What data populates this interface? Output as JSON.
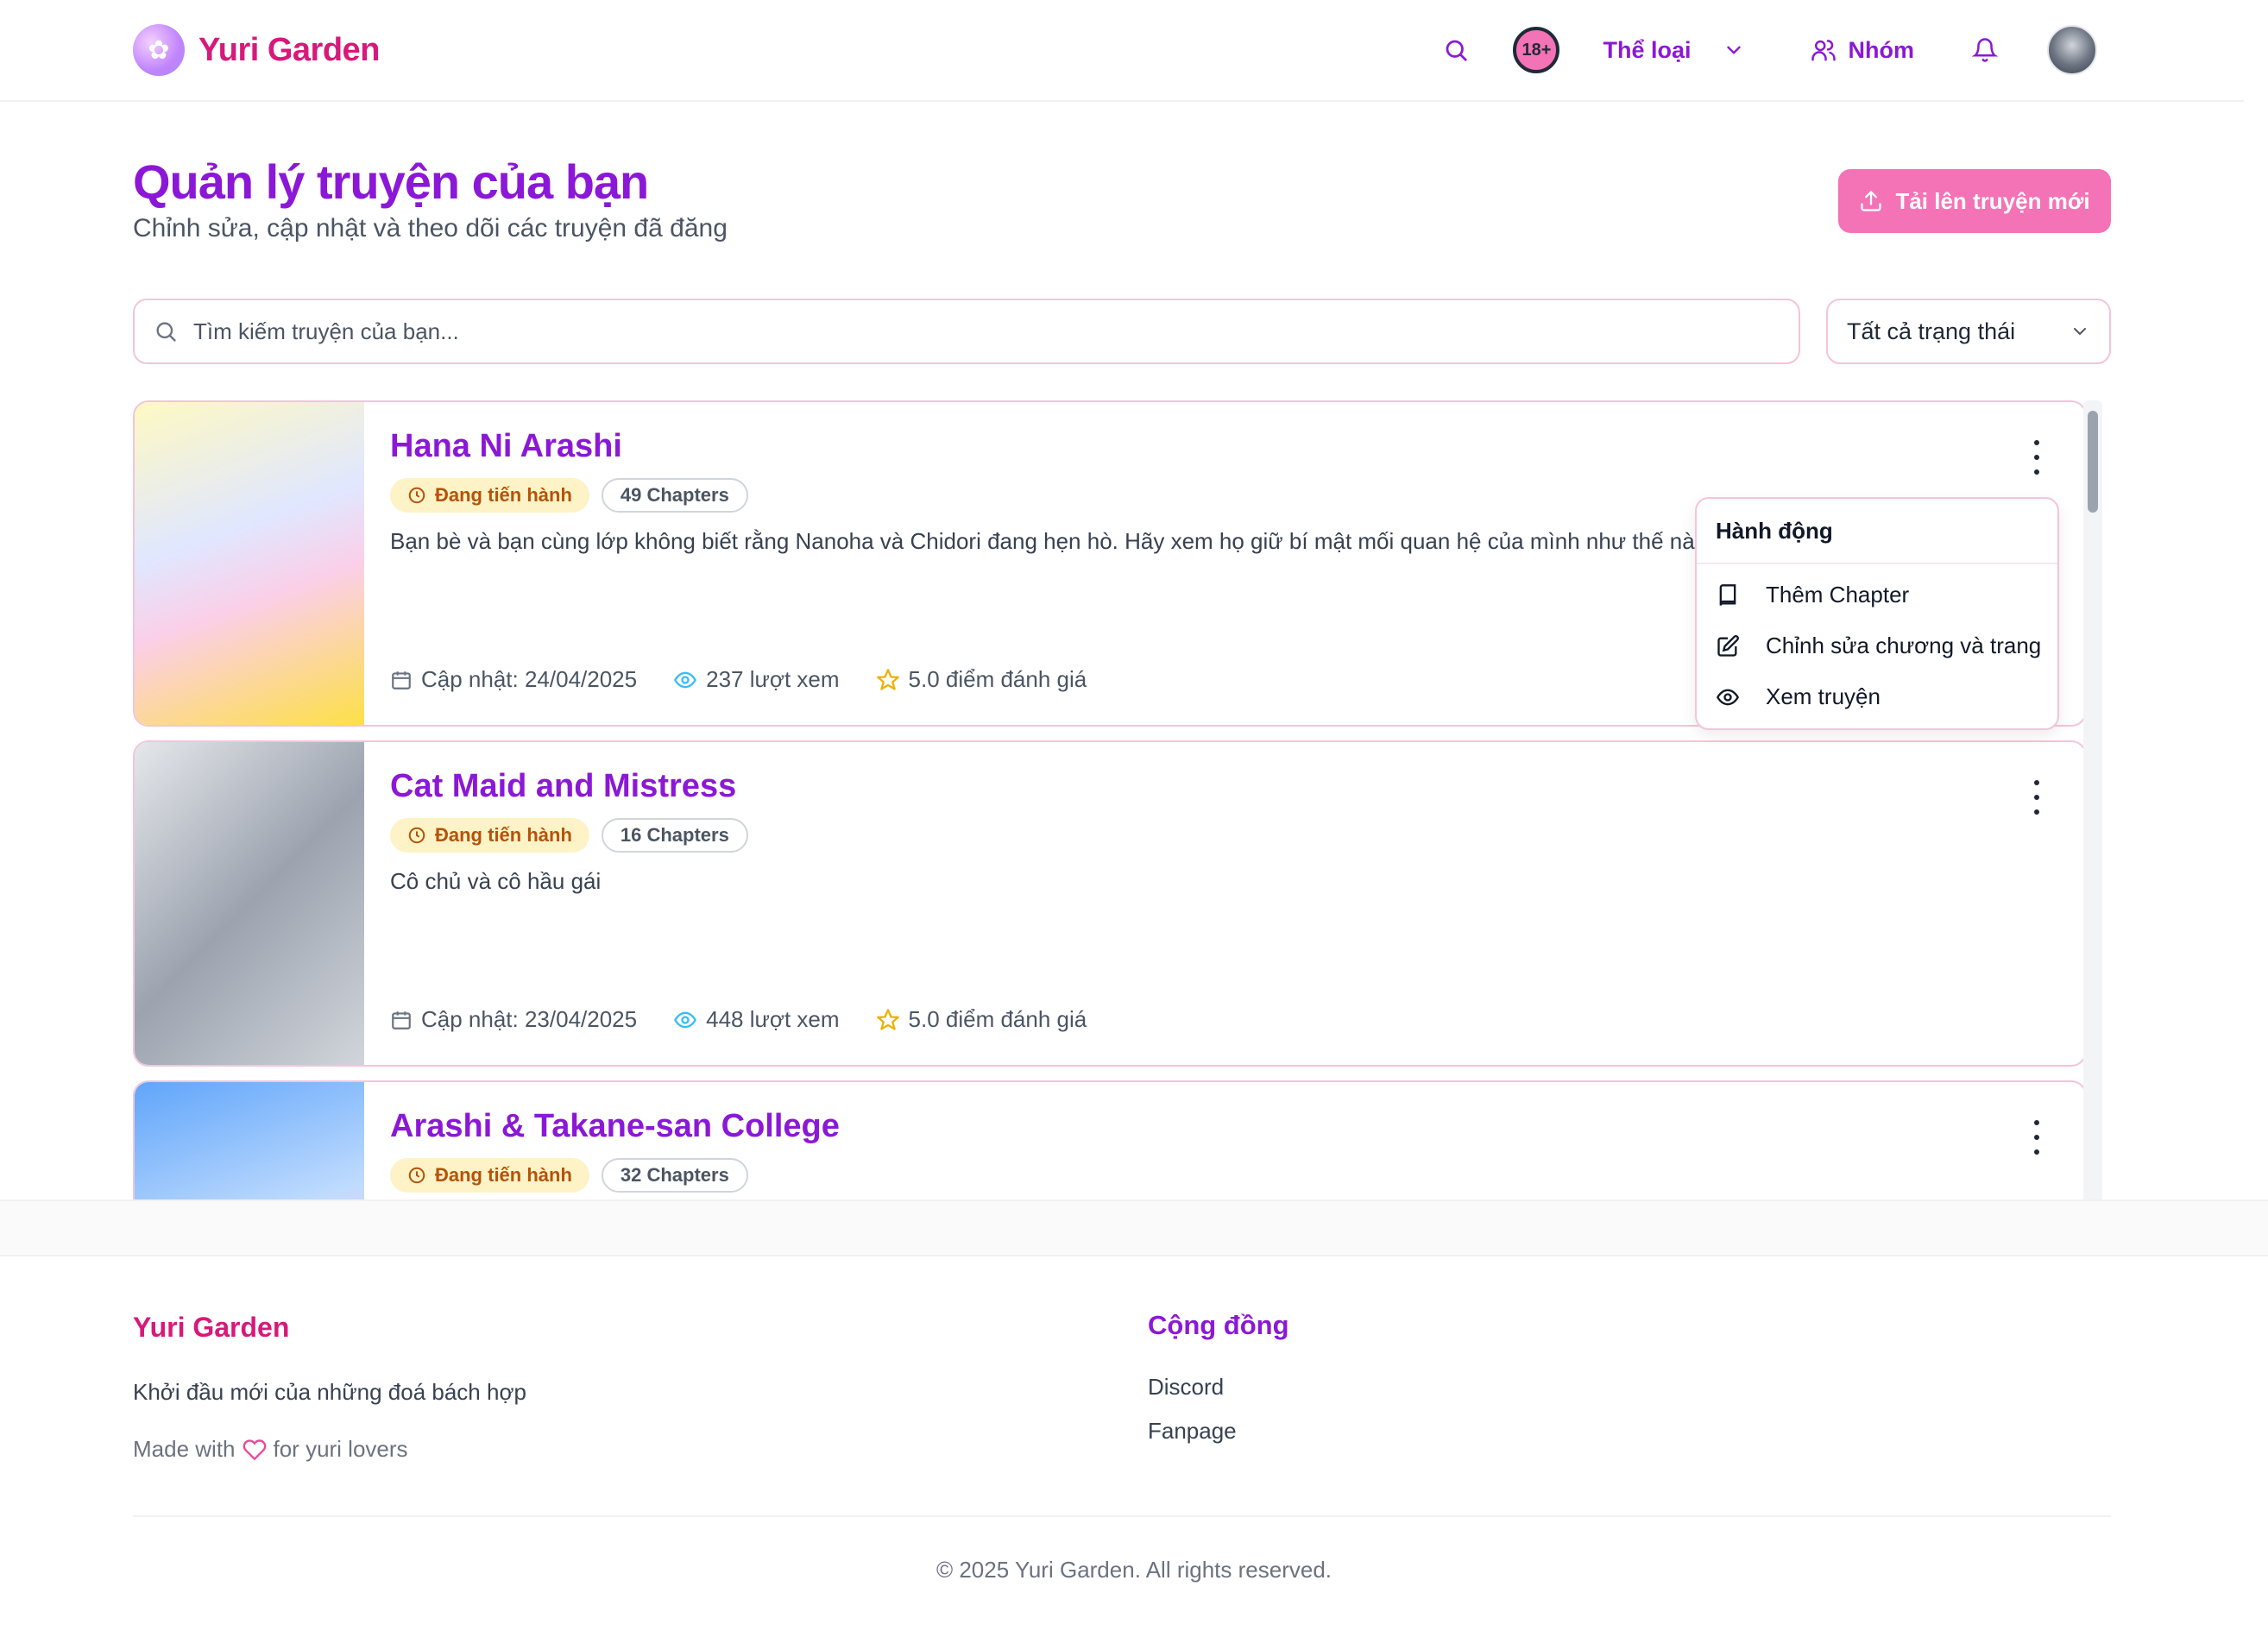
{
  "colors": {
    "brand_pink": "#d6197a",
    "primary_purple": "#8b18d6",
    "accent_pink": "#f472b6",
    "status_bg": "#fef3c7",
    "status_text": "#b45309",
    "star": "#eab308",
    "eye": "#38bdf8"
  },
  "header": {
    "brand_name": "Yuri Garden",
    "search_icon": "search-icon",
    "adult_badge": "18+",
    "genre_label": "Thể loại",
    "group_label": "Nhóm",
    "bell_icon": "bell-icon"
  },
  "page": {
    "title": "Quản lý truyện của bạn",
    "subtitle": "Chỉnh sửa, cập nhật và theo dõi các truyện đã đăng",
    "upload_label": "Tải lên truyện mới"
  },
  "filters": {
    "search_placeholder": "Tìm kiếm truyện của bạn...",
    "search_value": "",
    "status_selected": "Tất cả trạng thái"
  },
  "stories": [
    {
      "title": "Hana Ni Arashi",
      "status": "Đang tiến hành",
      "chapters": "49 Chapters",
      "description": "Bạn bè và bạn cùng lớp không biết rằng Nanoha và Chidori đang hẹn hò. Hãy xem họ giữ bí mật mối quan hệ của mình như thế nà",
      "updated": "Cập nhật: 24/04/2025",
      "views": "237 lượt xem",
      "rating": "5.0 điểm đánh giá"
    },
    {
      "title": "Cat Maid and Mistress",
      "status": "Đang tiến hành",
      "chapters": "16 Chapters",
      "description": "Cô chủ và cô hầu gái",
      "updated": "Cập nhật: 23/04/2025",
      "views": "448 lượt xem",
      "rating": "5.0 điểm đánh giá"
    },
    {
      "title": "Arashi & Takane-san College",
      "status": "Đang tiến hành",
      "chapters": "32 Chapters"
    }
  ],
  "action_menu": {
    "title": "Hành động",
    "items": [
      {
        "label": "Thêm Chapter",
        "icon": "book-icon"
      },
      {
        "label": "Chỉnh sửa chương và trang",
        "icon": "edit-icon"
      },
      {
        "label": "Xem truyện",
        "icon": "eye-icon"
      }
    ]
  },
  "footer": {
    "brand_name": "Yuri Garden",
    "tagline": "Khởi đầu mới của những đoá bách hợp",
    "made_prefix": "Made with",
    "made_suffix": "for yuri lovers",
    "community_title": "Cộng đồng",
    "links": [
      "Discord",
      "Fanpage"
    ],
    "copyright": "© 2025 Yuri Garden. All rights reserved."
  }
}
